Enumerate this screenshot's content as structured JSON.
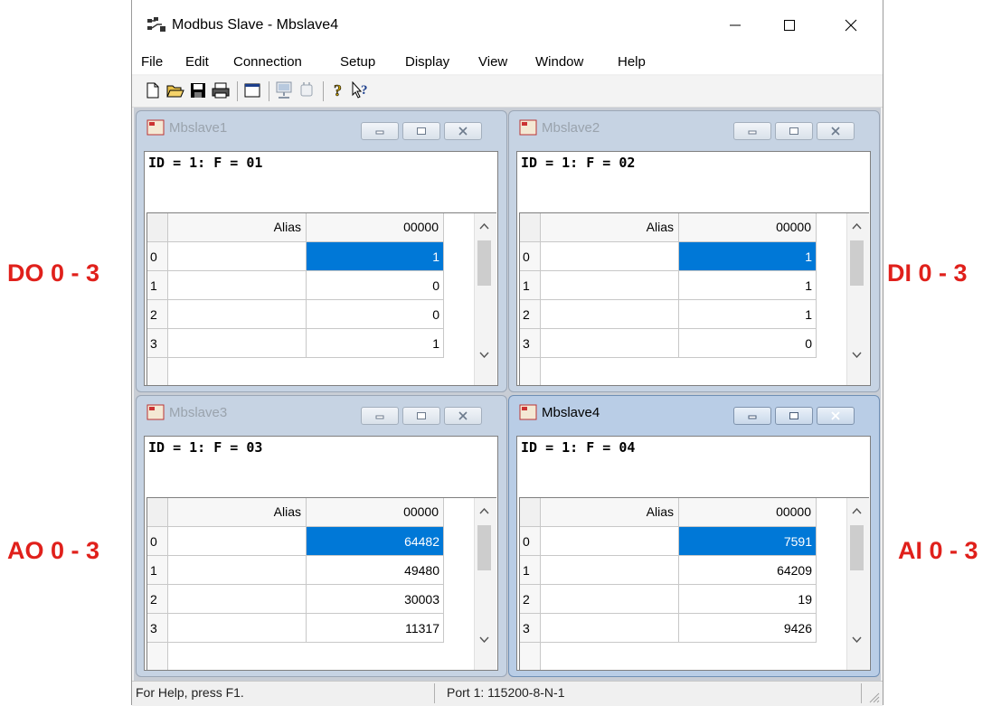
{
  "annotations": {
    "do_label": "DO 0 - 3",
    "di_label": "DI 0 - 3",
    "ao_label": "AO 0 - 3",
    "ai_label": "AI 0 - 3"
  },
  "window": {
    "title": "Modbus Slave - Mbslave4",
    "app_icon": "modbus-app-icon",
    "controls": [
      "minimize-icon",
      "maximize-icon",
      "close-icon"
    ]
  },
  "menu": [
    "File",
    "Edit",
    "Connection",
    "Setup",
    "Display",
    "View",
    "Window",
    "Help"
  ],
  "toolbar": [
    "new-icon",
    "open-icon",
    "save-icon",
    "print-icon",
    "window-icon",
    "connect-icon",
    "disconnect-icon",
    "help-icon",
    "whats-this-icon"
  ],
  "children": [
    {
      "title": "Mbslave1",
      "header": "ID = 1: F = 01",
      "active": false,
      "grid": {
        "alias_header": "Alias",
        "col_header": "00000",
        "rows": [
          "0",
          "1",
          "2",
          "3"
        ],
        "values": [
          "1",
          "0",
          "0",
          "1"
        ]
      }
    },
    {
      "title": "Mbslave2",
      "header": "ID = 1: F = 02",
      "active": false,
      "grid": {
        "alias_header": "Alias",
        "col_header": "00000",
        "rows": [
          "0",
          "1",
          "2",
          "3"
        ],
        "values": [
          "1",
          "1",
          "1",
          "0"
        ]
      }
    },
    {
      "title": "Mbslave3",
      "header": "ID = 1: F = 03",
      "active": false,
      "grid": {
        "alias_header": "Alias",
        "col_header": "00000",
        "rows": [
          "0",
          "1",
          "2",
          "3"
        ],
        "values": [
          "64482",
          "49480",
          "30003",
          "11317"
        ]
      }
    },
    {
      "title": "Mbslave4",
      "header": "ID = 1: F = 04",
      "active": true,
      "grid": {
        "alias_header": "Alias",
        "col_header": "00000",
        "rows": [
          "0",
          "1",
          "2",
          "3"
        ],
        "values": [
          "7591",
          "64209",
          "19",
          "9426"
        ]
      }
    }
  ],
  "status": {
    "help_text": "For Help, press F1.",
    "port_text": "Port 1: 115200-8-N-1"
  },
  "colors": {
    "annotation": "#e0201b",
    "selection": "#0078d7"
  }
}
